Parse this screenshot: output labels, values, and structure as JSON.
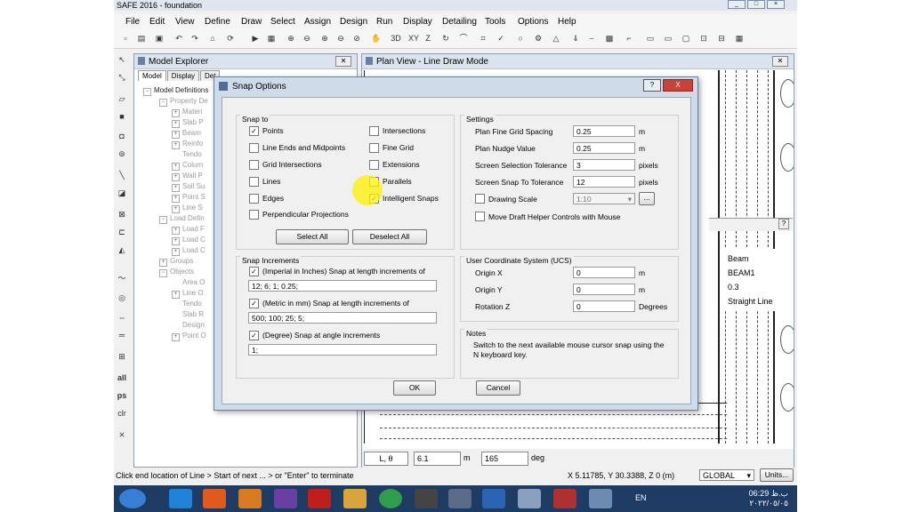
{
  "window": {
    "title": "SAFE 2016 - foundation"
  },
  "menu": [
    "File",
    "Edit",
    "View",
    "Define",
    "Draw",
    "Select",
    "Assign",
    "Design",
    "Run",
    "Display",
    "Detailing",
    "Tools",
    "Options",
    "Help"
  ],
  "toolbar": {
    "text_buttons": [
      "3D",
      "XY",
      "Z"
    ]
  },
  "left_tools": {
    "labels": [
      "all",
      "ps",
      "clr"
    ]
  },
  "model_explorer": {
    "title": "Model Explorer",
    "tabs": [
      "Model",
      "Display",
      "Det"
    ],
    "tree": [
      "Model Definitions",
      "Property De",
      "Materi",
      "Slab P",
      "Beam",
      "Reinfo",
      "Tendo",
      "Colum",
      "Wall P",
      "Soil Su",
      "Point S",
      "Line S",
      "Load Defin",
      "Load F",
      "Load C",
      "Load C",
      "Groups",
      "Objects",
      "Area O",
      "Line O",
      "Tendo",
      "Slab R",
      "Design",
      "Point O"
    ]
  },
  "plan_view": {
    "title": "Plan View - Line Draw Mode",
    "help": "?",
    "properties": {
      "type": "Beam",
      "name": "BEAM1",
      "value": "0.3",
      "mode": "Straight Line"
    },
    "bottom": {
      "mode": "L, θ",
      "length": "6.1",
      "length_unit": "m",
      "angle": "165",
      "angle_unit": "deg"
    }
  },
  "status": {
    "hint": "Click end location of Line > Start of next ... > or \"Enter\" to terminate",
    "coords": "X 5.11785, Y 30.3388, Z 0  (m)",
    "system": "GLOBAL",
    "units_button": "Units..."
  },
  "taskbar": {
    "lang": "EN",
    "time": "06:29 ب.ظ",
    "date": "٢٠٢٢/٠٥/٠٥"
  },
  "dialog": {
    "title": "Snap Options",
    "help": "?",
    "close": "X",
    "snap_to": {
      "label": "Snap to",
      "left": [
        {
          "label": "Points",
          "checked": true
        },
        {
          "label": "Line Ends and Midpoints",
          "checked": false
        },
        {
          "label": "Grid Intersections",
          "checked": false
        },
        {
          "label": "Lines",
          "checked": false
        },
        {
          "label": "Edges",
          "checked": false
        },
        {
          "label": "Perpendicular Projections",
          "checked": false
        }
      ],
      "right": [
        {
          "label": "Intersections",
          "checked": false
        },
        {
          "label": "Fine Grid",
          "checked": false
        },
        {
          "label": "Extensions",
          "checked": false
        },
        {
          "label": "Parallels",
          "checked": false
        },
        {
          "label": "Intelligent Snaps",
          "checked": true
        }
      ],
      "select_all": "Select All",
      "deselect_all": "Deselect All"
    },
    "settings": {
      "label": "Settings",
      "plan_fine_grid_label": "Plan Fine Grid Spacing",
      "plan_fine_grid_value": "0.25",
      "plan_fine_grid_unit": "m",
      "nudge_label": "Plan Nudge Value",
      "nudge_value": "0.25",
      "nudge_unit": "m",
      "sel_tol_label": "Screen Selection Tolerance",
      "sel_tol_value": "3",
      "sel_tol_unit": "pixels",
      "snap_tol_label": "Screen Snap To Tolerance",
      "snap_tol_value": "12",
      "snap_tol_unit": "pixels",
      "drawing_scale_label": "Drawing Scale",
      "drawing_scale_checked": false,
      "drawing_scale_value": "1:10",
      "drawing_scale_more": "...",
      "move_draft_label": "Move Draft Helper Controls with Mouse",
      "move_draft_checked": false
    },
    "increments": {
      "label": "Snap Increments",
      "imperial_label": "(Imperial in Inches) Snap at length increments of",
      "imperial_checked": true,
      "imperial_value": "12; 6; 1; 0.25;",
      "metric_label": "(Metric in mm) Snap at length increments of",
      "metric_checked": true,
      "metric_value": "500; 100; 25; 5;",
      "degree_label": "(Degree) Snap at angle increments",
      "degree_checked": true,
      "degree_value": "1;"
    },
    "ucs": {
      "label": "User Coordinate System (UCS)",
      "x_label": "Origin X",
      "x_value": "0",
      "x_unit": "m",
      "y_label": "Origin Y",
      "y_value": "0",
      "y_unit": "m",
      "rot_label": "Rotation Z",
      "rot_value": "0",
      "rot_unit": "Degrees"
    },
    "notes": {
      "label": "Notes",
      "text": "Switch to the next available mouse cursor snap using the N keyboard key."
    },
    "ok": "OK",
    "cancel": "Cancel"
  }
}
